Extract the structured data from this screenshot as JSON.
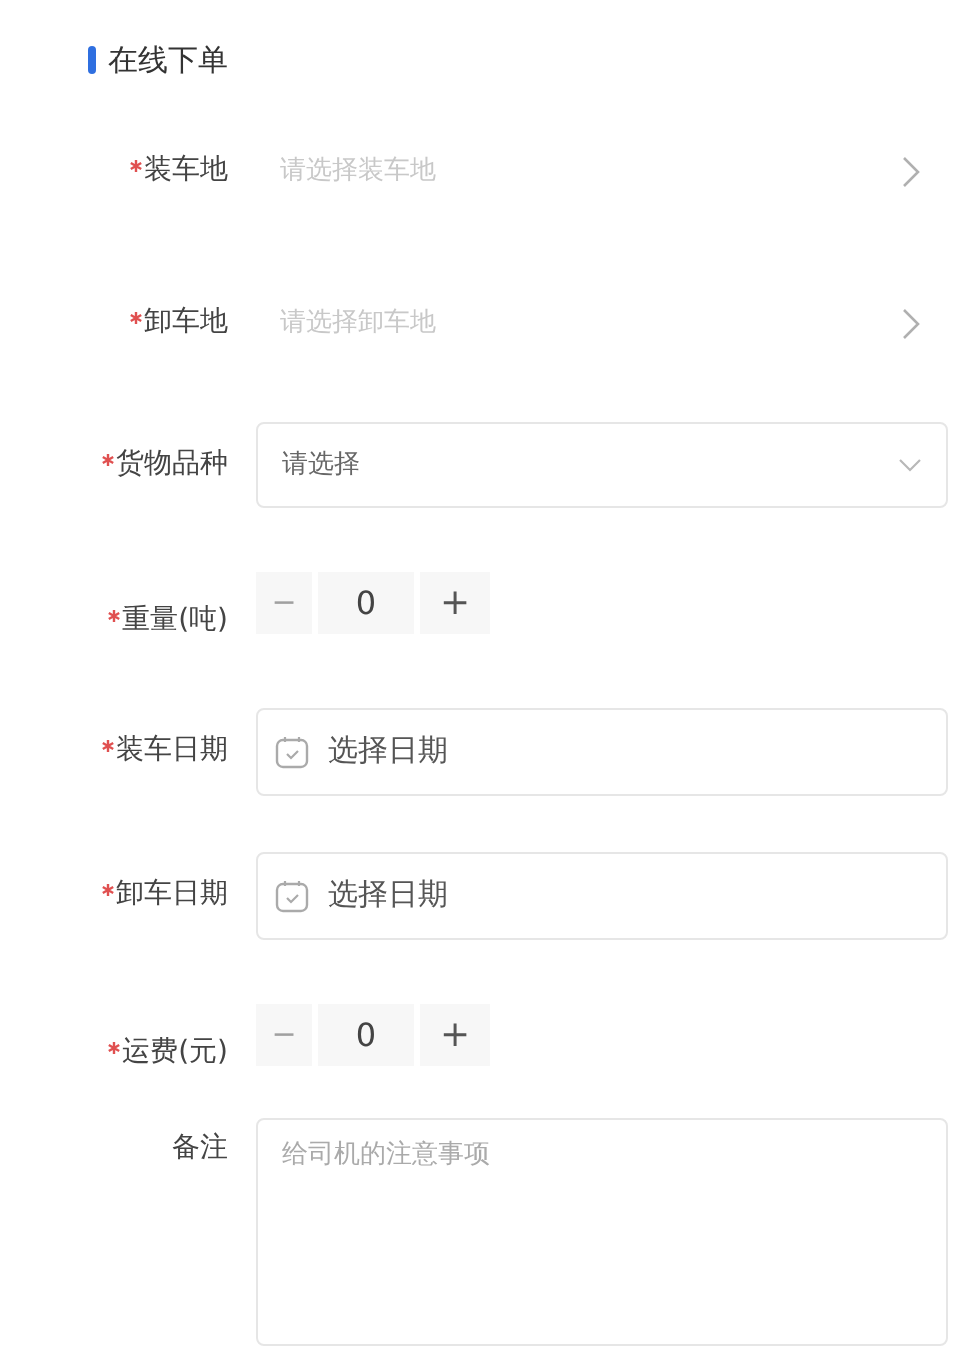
{
  "title": "在线下单",
  "fields": [
    {
      "kind": "picker",
      "label": "装车地",
      "required": true,
      "placeholder": "请选择装车地"
    },
    {
      "kind": "picker",
      "label": "卸车地",
      "required": true,
      "placeholder": "请选择卸车地"
    },
    {
      "kind": "select",
      "label": "货物品种",
      "required": true,
      "placeholder": "请选择"
    },
    {
      "kind": "stepper",
      "label": "重量(吨)",
      "required": true,
      "value": "0",
      "minus": "−",
      "plus": "+",
      "minus_disabled": true
    },
    {
      "kind": "date",
      "label": "装车日期",
      "required": true,
      "placeholder": "选择日期"
    },
    {
      "kind": "date",
      "label": "卸车日期",
      "required": true,
      "placeholder": "选择日期"
    },
    {
      "kind": "stepper",
      "label": "运费(元)",
      "required": true,
      "value": "0",
      "minus": "−",
      "plus": "+",
      "minus_disabled": true
    },
    {
      "kind": "textarea",
      "label": "备注",
      "required": false,
      "placeholder": "给司机的注意事项"
    }
  ]
}
